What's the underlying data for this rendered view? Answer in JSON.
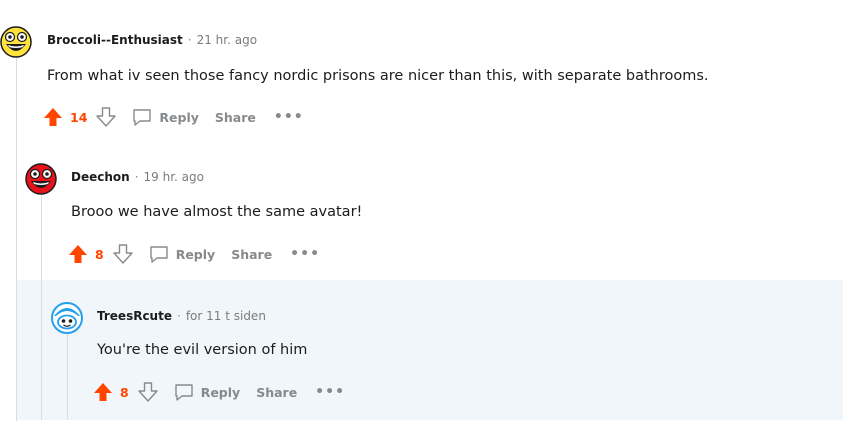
{
  "comments": [
    {
      "author": "Broccoli--Enthusiast",
      "time": "21 hr. ago",
      "body": "From what iv seen those fancy nordic prisons are nicer than this, with separate bathrooms.",
      "score": "14",
      "reply": "Reply",
      "share": "Share",
      "more": "•••",
      "avatar": "yellow-smiley-avatar"
    },
    {
      "author": "Deechon",
      "time": "19 hr. ago",
      "body": "Brooo we have almost the same avatar!",
      "score": "8",
      "reply": "Reply",
      "share": "Share",
      "more": "•••",
      "avatar": "red-smiley-avatar"
    },
    {
      "author": "TreesRcute",
      "time": "for 11 t siden",
      "body": "You're the evil version of him",
      "score": "8",
      "reply": "Reply",
      "share": "Share",
      "more": "•••",
      "avatar": "snoo-avatar"
    }
  ],
  "separator": "·",
  "colors": {
    "upvote": "#ff4500",
    "muted": "#878a8c",
    "highlight": "#f1f6fa"
  }
}
